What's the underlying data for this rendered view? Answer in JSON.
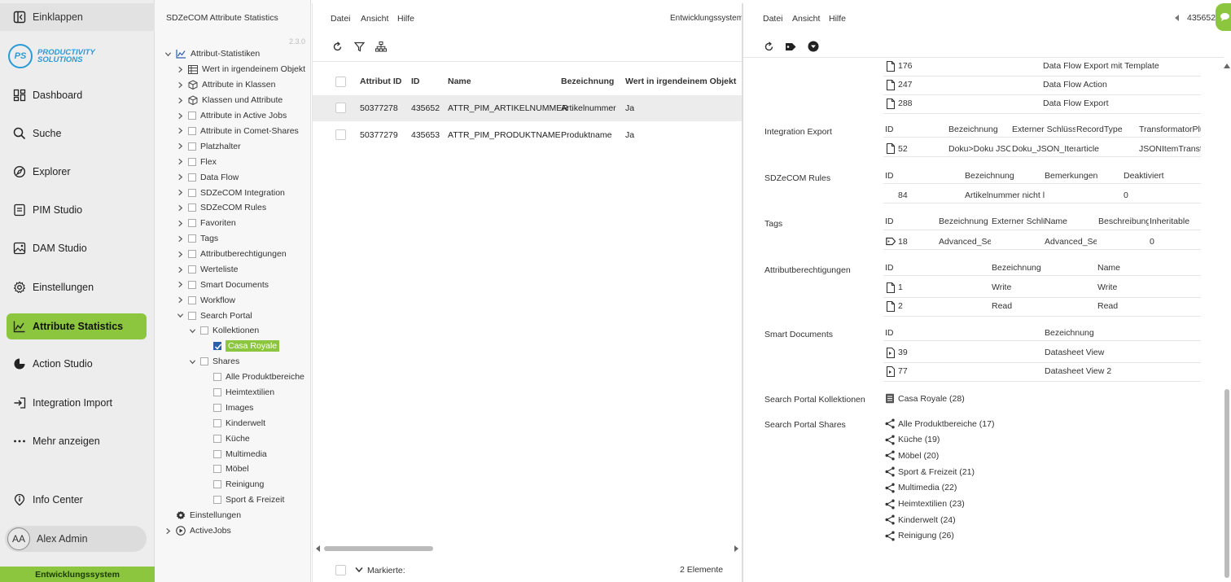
{
  "nav": {
    "collapse_label": "Einklappen",
    "logo": {
      "abbr": "PS",
      "line1": "PRODUCTIVITY",
      "line2": "SOLUTIONS"
    },
    "items": [
      {
        "label": "Dashboard",
        "icon": "dashboard-icon"
      },
      {
        "label": "Suche",
        "icon": "search-icon"
      },
      {
        "label": "Explorer",
        "icon": "explorer-icon"
      },
      {
        "label": "PIM Studio",
        "icon": "pim-studio-icon"
      },
      {
        "label": "DAM Studio",
        "icon": "image-icon"
      },
      {
        "label": "Einstellungen",
        "icon": "gear-icon"
      },
      {
        "label": "Attribute Statistics",
        "icon": "chart-icon"
      },
      {
        "label": "Action Studio",
        "icon": "action-icon"
      },
      {
        "label": "Integration Import",
        "icon": "import-icon"
      },
      {
        "label": "Mehr anzeigen",
        "icon": "more-icon"
      }
    ],
    "info_center": "Info Center",
    "user": {
      "initials": "AA",
      "name": "Alex Admin"
    },
    "env": "Entwicklungssystem"
  },
  "tree": {
    "title": "SDZeCOM Attribute Statistics",
    "version": "2.3.0",
    "root": "Attribut-Statistiken",
    "items": [
      "Wert in irgendeinem Objekt",
      "Attribute in Klassen",
      "Klassen und Attribute",
      "Attribute in Active Jobs",
      "Attribute in Comet-Shares",
      "Platzhalter",
      "Flex",
      "Data Flow",
      "SDZeCOM Integration",
      "SDZeCOM Rules",
      "Favoriten",
      "Tags",
      "Attributberechtigungen",
      "Werteliste",
      "Smart Documents",
      "Workflow",
      "Search Portal"
    ],
    "kollektionen": "Kollektionen",
    "casa_royale": "Casa Royale",
    "shares": "Shares",
    "share_items": [
      "Alle Produktbereiche",
      "Heimtextilien",
      "Images",
      "Kinderwelt",
      "Küche",
      "Multimedia",
      "Möbel",
      "Reinigung",
      "Sport & Freizeit"
    ],
    "einstellungen": "Einstellungen",
    "activejobs": "ActiveJobs"
  },
  "list": {
    "menu": [
      "Datei",
      "Ansicht",
      "Hilfe"
    ],
    "env": "Entwicklungssystem",
    "columns": [
      "Attribut ID",
      "ID",
      "Name",
      "Bezeichnung",
      "Wert in irgendeinem Objekt"
    ],
    "rows": [
      [
        "50377278",
        "435652",
        "ATTR_PIM_ARTIKELNUMMER",
        "Artikelnummer",
        "Ja"
      ],
      [
        "50377279",
        "435653",
        "ATTR_PIM_PRODUKTNAME",
        "Produktname",
        "Ja"
      ]
    ],
    "footer_label": "Markierte:",
    "count": "2 Elemente"
  },
  "detail": {
    "menu": [
      "Datei",
      "Ansicht",
      "Hilfe"
    ],
    "object_id": "435652",
    "dataflow_rows": [
      {
        "id": "176",
        "name": "Data Flow Export mit Template"
      },
      {
        "id": "247",
        "name": "Data Flow Action"
      },
      {
        "id": "288",
        "name": "Data Flow Export"
      }
    ],
    "integration_export": {
      "label": "Integration Export",
      "headers": [
        "ID",
        "Bezeichnung",
        "Externer Schlüsse",
        "RecordType",
        "TransformatorPlu"
      ],
      "row": [
        "52",
        "Doku>Doku JSON",
        "Doku_JSON_Item_Pdm",
        "article",
        "JSONItemTransfo"
      ]
    },
    "rules": {
      "label": "SDZeCOM Rules",
      "headers": [
        "ID",
        "Bezeichnung",
        "Bemerkungen",
        "Deaktiviert"
      ],
      "row": [
        "84",
        "Artikelnummer nicht l",
        "",
        "0"
      ]
    },
    "tags": {
      "label": "Tags",
      "headers": [
        "ID",
        "Bezeichnung",
        "Externer Schlü",
        "Name",
        "Beschreibung",
        "Inheritable"
      ],
      "row": [
        "18",
        "Advanced_Sea",
        "",
        "Advanced_Sea",
        "",
        "0"
      ]
    },
    "perms": {
      "label": "Attributberechtigungen",
      "headers": [
        "ID",
        "Bezeichnung",
        "Name"
      ],
      "rows": [
        [
          "1",
          "Write",
          "Write"
        ],
        [
          "2",
          "Read",
          "Read"
        ]
      ]
    },
    "smart": {
      "label": "Smart Documents",
      "headers": [
        "ID",
        "Bezeichnung"
      ],
      "rows": [
        [
          "39",
          "Datasheet View"
        ],
        [
          "77",
          "Datasheet View 2"
        ]
      ]
    },
    "kollektionen": {
      "label": "Search Portal Kollektionen",
      "value": "Casa Royale (28)"
    },
    "shares": {
      "label": "Search Portal Shares",
      "items": [
        "Alle Produktbereiche (17)",
        "Küche (19)",
        "Möbel (20)",
        "Sport & Freizeit (21)",
        "Multimedia (22)",
        "Heimtextilien (23)",
        "Kinderwelt (24)",
        "Reinigung (26)"
      ]
    }
  },
  "colors": {
    "accent": "#8cc63f",
    "brand": "#2a9bd6"
  }
}
